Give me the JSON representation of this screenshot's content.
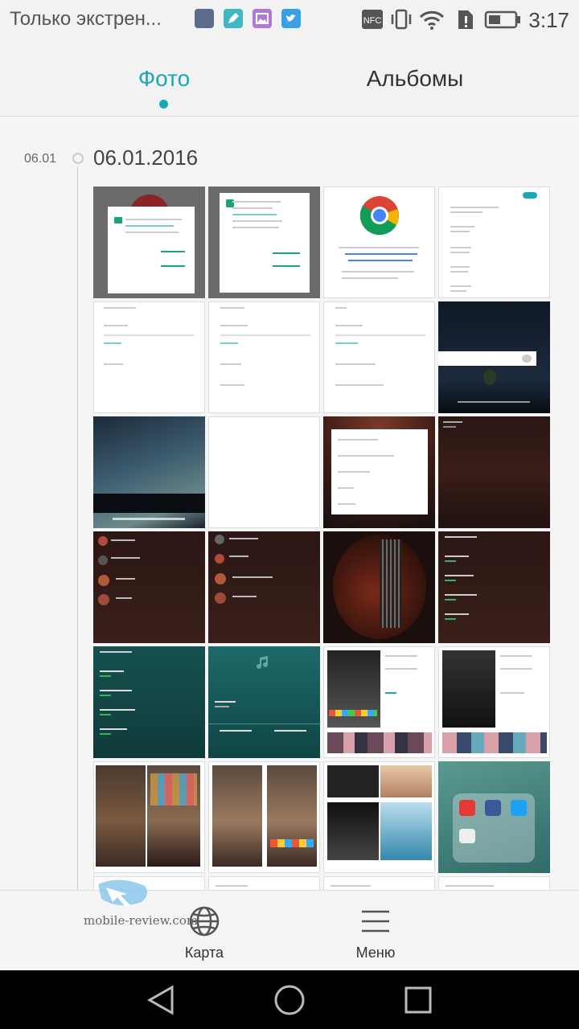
{
  "status_bar": {
    "notification_text": "Только экстрен...",
    "time": "3:17",
    "nfc": "NFC",
    "icons": [
      "app-notification-icon",
      "edit-notification-icon",
      "gallery-notification-icon",
      "twitter-notification-icon",
      "nfc-icon",
      "vibrate-icon",
      "wifi-icon",
      "sim-alert-icon",
      "battery-icon"
    ]
  },
  "tabs": [
    {
      "label": "Фото",
      "active": true
    },
    {
      "label": "Альбомы",
      "active": false
    }
  ],
  "timeline": {
    "short_date": "06.01",
    "long_date": "06.01.2016"
  },
  "bottom_bar": {
    "map_label": "Карта",
    "menu_label": "Меню"
  },
  "watermark": "mobile-review.com",
  "colors": {
    "accent": "#19a8b5",
    "text_primary": "#333333",
    "background": "#f5f5f5",
    "navbar": "#000000"
  }
}
